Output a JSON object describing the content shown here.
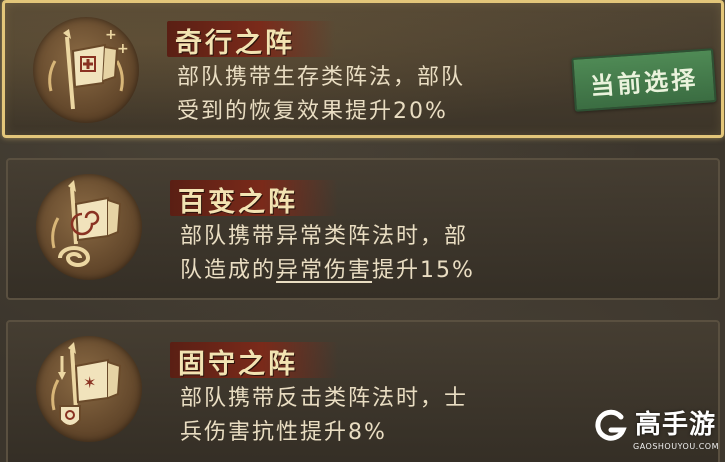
{
  "formations": [
    {
      "title": "奇行之阵",
      "desc_line1": "部队携带生存类阵法，部队",
      "desc_line2": "受到的恢复效果提升20%",
      "badge": "当前选择",
      "icon": "heal-banner-icon",
      "selected": true
    },
    {
      "title": "百变之阵",
      "desc_line1": "部队携带异常类阵法时，部",
      "desc_line2_pre": "队造成的",
      "desc_line2_keyword": "异常伤害",
      "desc_line2_post": "提升15%",
      "icon": "swirl-banner-icon",
      "selected": false
    },
    {
      "title": "固守之阵",
      "desc_line1": "部队携带反击类阵法时，士",
      "desc_line2": "兵伤害抗性提升8%",
      "icon": "shield-banner-icon",
      "selected": false
    }
  ],
  "watermark": {
    "brand": "高手游",
    "url": "GAOSHOUYOU.COM"
  },
  "colors": {
    "selected_border": "#e3c67a",
    "title_plate": "#7a2a1a",
    "badge_green": "#4f8a55",
    "text": "#e9ddc2"
  }
}
